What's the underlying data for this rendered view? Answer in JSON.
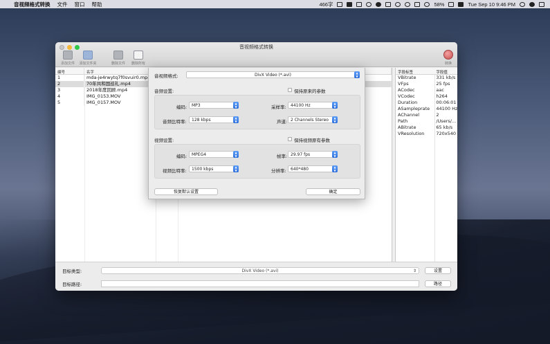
{
  "menubar": {
    "app_name": "音视频格式转换",
    "menus": [
      "文件",
      "窗口",
      "帮助"
    ],
    "char_count": "466字",
    "battery": "58%",
    "clock": "Tue Sep 10  9:46 PM"
  },
  "window": {
    "title": "音视频格式转换",
    "toolbar": [
      {
        "label": "添加文件",
        "icon": "add-file-icon"
      },
      {
        "label": "添加文件夹",
        "icon": "add-folder-icon"
      },
      {
        "label": "删除文件",
        "icon": "delete-file-icon"
      },
      {
        "label": "删除所有",
        "icon": "delete-all-icon"
      }
    ],
    "convert_label": "转换"
  },
  "file_table": {
    "headers": [
      "编号",
      "名字",
      "",
      ""
    ],
    "rows": [
      {
        "no": "1",
        "name": "mda-je4rwytq7f0svuir0.mp4"
      },
      {
        "no": "2",
        "name": "70年共和国巡礼.mp4"
      },
      {
        "no": "3",
        "name": "2018年度回顾.mp4"
      },
      {
        "no": "4",
        "name": "IMG_0153.MOV"
      },
      {
        "no": "5",
        "name": "IMG_0157.MOV"
      }
    ],
    "selected_index": 1
  },
  "props_table": {
    "headers": [
      "字段标签",
      "字段值"
    ],
    "rows": [
      {
        "k": "VBitrate",
        "v": "331 kb/s"
      },
      {
        "k": "VFps",
        "v": "25 fps"
      },
      {
        "k": "ACodec",
        "v": "aac"
      },
      {
        "k": "VCodec",
        "v": "h264"
      },
      {
        "k": "Duration",
        "v": "00:06:01"
      },
      {
        "k": "ASampleprate",
        "v": "44100 Hz"
      },
      {
        "k": "AChannel",
        "v": "2"
      },
      {
        "k": "Path",
        "v": "/Users/..."
      },
      {
        "k": "ABitrate",
        "v": "65 kb/s"
      },
      {
        "k": "VResolution",
        "v": "720x540"
      }
    ]
  },
  "bottom": {
    "target_type_label": "目标类型:",
    "target_type_value": "DivX Video (*.avi)",
    "settings_btn": "设置",
    "target_path_label": "目标路径:",
    "target_path_value": "",
    "path_btn": "路径"
  },
  "dialog": {
    "format_label": "音视频格式:",
    "format_value": "DivX Video (*.avi)",
    "audio_section": "音频设置:",
    "keep_audio": "保持原来的参数",
    "codec_label": "编码:",
    "audio_codec": "MP3",
    "samplerate_label": "采样率:",
    "samplerate": "44100 Hz",
    "abitrate_label": "音频比特率:",
    "abitrate": "128 kbps",
    "channel_label": "声道:",
    "channel": "2 Channels Stereo",
    "video_section": "视频设置:",
    "keep_video": "保持视频原有参数",
    "vcodec_label": "编码:",
    "video_codec": "MPEG4",
    "fps_label": "帧率:",
    "fps": "29.97 fps",
    "vbitrate_label": "视频比特率:",
    "vbitrate": "1500 kbps",
    "resolution_label": "分辨率:",
    "resolution": "640*480",
    "reset_btn": "恢复默认设置",
    "ok_btn": "确定"
  }
}
